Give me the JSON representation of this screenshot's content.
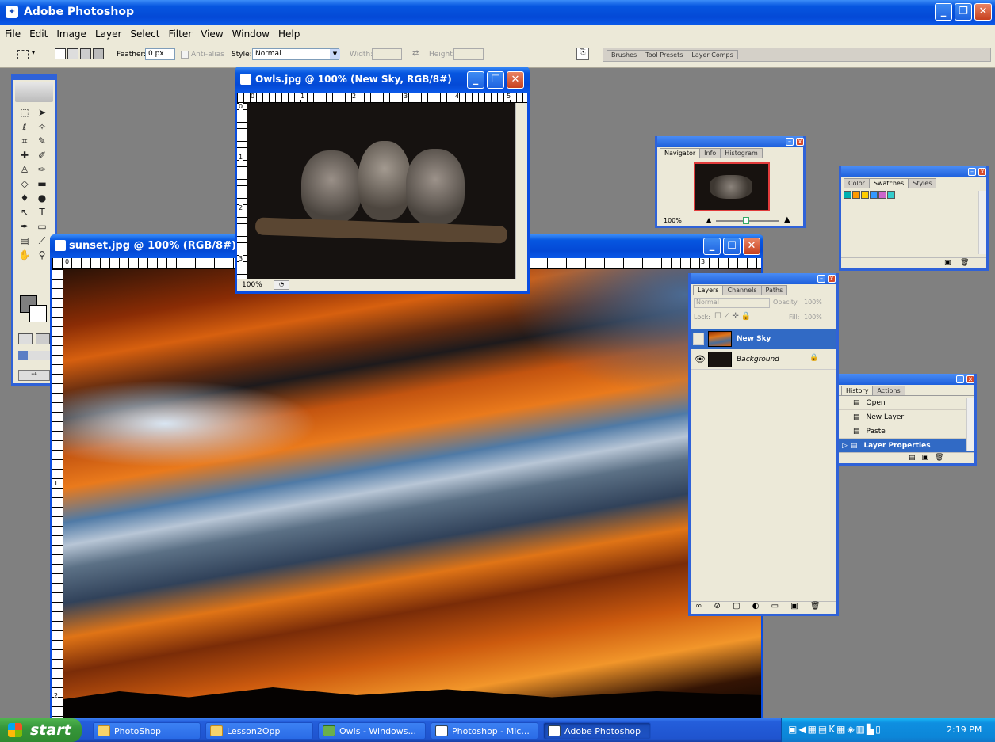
{
  "app": {
    "title": "Adobe Photoshop"
  },
  "menu": [
    "File",
    "Edit",
    "Image",
    "Layer",
    "Select",
    "Filter",
    "View",
    "Window",
    "Help"
  ],
  "options": {
    "feather_label": "Feather:",
    "feather_value": "0 px",
    "antialias_label": "Anti-alias",
    "style_label": "Style:",
    "style_value": "Normal",
    "width_label": "Width:",
    "height_label": "Height:",
    "well_tabs": [
      "Brushes",
      "Tool Presets",
      "Layer Comps"
    ]
  },
  "owls_window": {
    "title": "Owls.jpg @ 100% (New Sky, RGB/8#)",
    "zoom": "100%",
    "ruler_top": [
      "0",
      "1",
      "2",
      "3",
      "4",
      "5"
    ],
    "ruler_left": [
      "0",
      "1",
      "2",
      "3"
    ]
  },
  "sunset_window": {
    "title": "sunset.jpg @ 100% (RGB/8#)",
    "ruler_top": [
      "0",
      "3"
    ],
    "ruler_left": [
      "1",
      "2"
    ]
  },
  "navigator": {
    "tabs": [
      "Navigator",
      "Info",
      "Histogram"
    ],
    "zoom": "100%"
  },
  "swatches": {
    "tabs": [
      "Color",
      "Swatches",
      "Styles"
    ],
    "colors": [
      "#00b0b0",
      "#ff9900",
      "#ffcc00",
      "#3399ff",
      "#cc66cc",
      "#33cccc"
    ]
  },
  "layers": {
    "tabs": [
      "Layers",
      "Channels",
      "Paths"
    ],
    "blend": "Normal",
    "opacity_label": "Opacity:",
    "opacity_value": "100%",
    "lock_label": "Lock:",
    "fill_label": "Fill:",
    "fill_value": "100%",
    "items": [
      {
        "name": "New Sky",
        "selected": true
      },
      {
        "name": "Background",
        "selected": false
      }
    ]
  },
  "history": {
    "tabs": [
      "History",
      "Actions"
    ],
    "items": [
      "Open",
      "New Layer",
      "Paste",
      "Layer Properties"
    ],
    "active_index": 3
  },
  "taskbar": {
    "start": "start",
    "items": [
      "PhotoShop",
      "Lesson2Opp",
      "Owls - Windows...",
      "Photoshop - Mic...",
      "Adobe Photoshop"
    ],
    "clock": "2:19 PM"
  }
}
